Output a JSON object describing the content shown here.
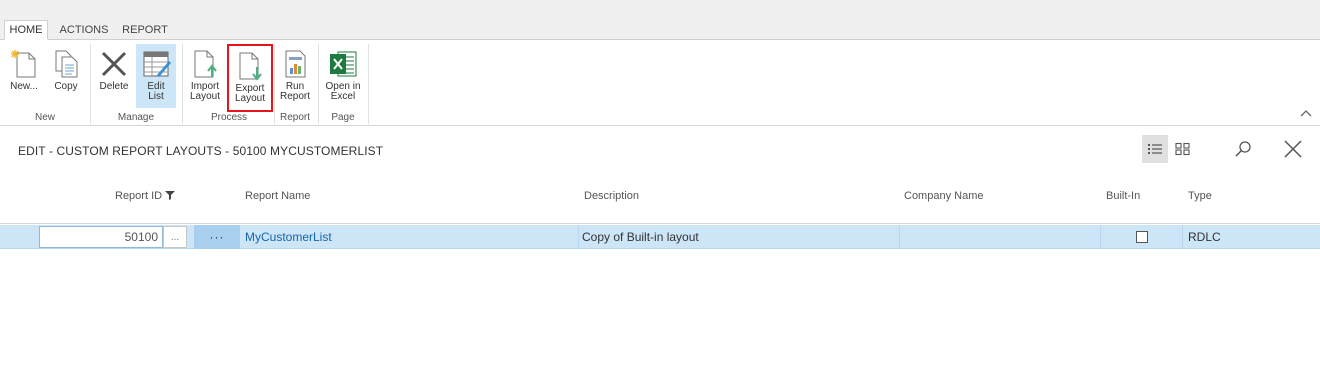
{
  "tabs": [
    {
      "label": "HOME",
      "active": true
    },
    {
      "label": "ACTIONS",
      "active": false
    },
    {
      "label": "REPORT",
      "active": false
    }
  ],
  "ribbon": {
    "buttons": {
      "new": "New...",
      "copy": "Copy",
      "delete": "Delete",
      "edit_list_1": "Edit",
      "edit_list_2": "List",
      "import_1": "Import",
      "import_2": "Layout",
      "export_1": "Export",
      "export_2": "Layout",
      "run_1": "Run",
      "run_2": "Report",
      "excel_1": "Open in",
      "excel_2": "Excel"
    },
    "groups": {
      "new": "New",
      "manage": "Manage",
      "process": "Process",
      "report": "Report",
      "page": "Page"
    }
  },
  "page": {
    "title": "EDIT - CUSTOM REPORT LAYOUTS - 50100 MYCUSTOMERLIST"
  },
  "grid": {
    "headers": {
      "report_id": "Report ID",
      "report_name": "Report Name",
      "description": "Description",
      "company_name": "Company Name",
      "built_in": "Built-In",
      "type": "Type"
    },
    "rows": [
      {
        "report_id": "50100",
        "lookup": "...",
        "more": "···",
        "report_name": "MyCustomerList",
        "description": "Copy of Built-in layout",
        "company_name": "",
        "built_in": false,
        "type": "RDLC"
      }
    ]
  },
  "colors": {
    "selected_row": "#cde6f7",
    "link": "#1565a8",
    "highlight_border": "#e8141c",
    "excel_green": "#1f7a3f"
  }
}
